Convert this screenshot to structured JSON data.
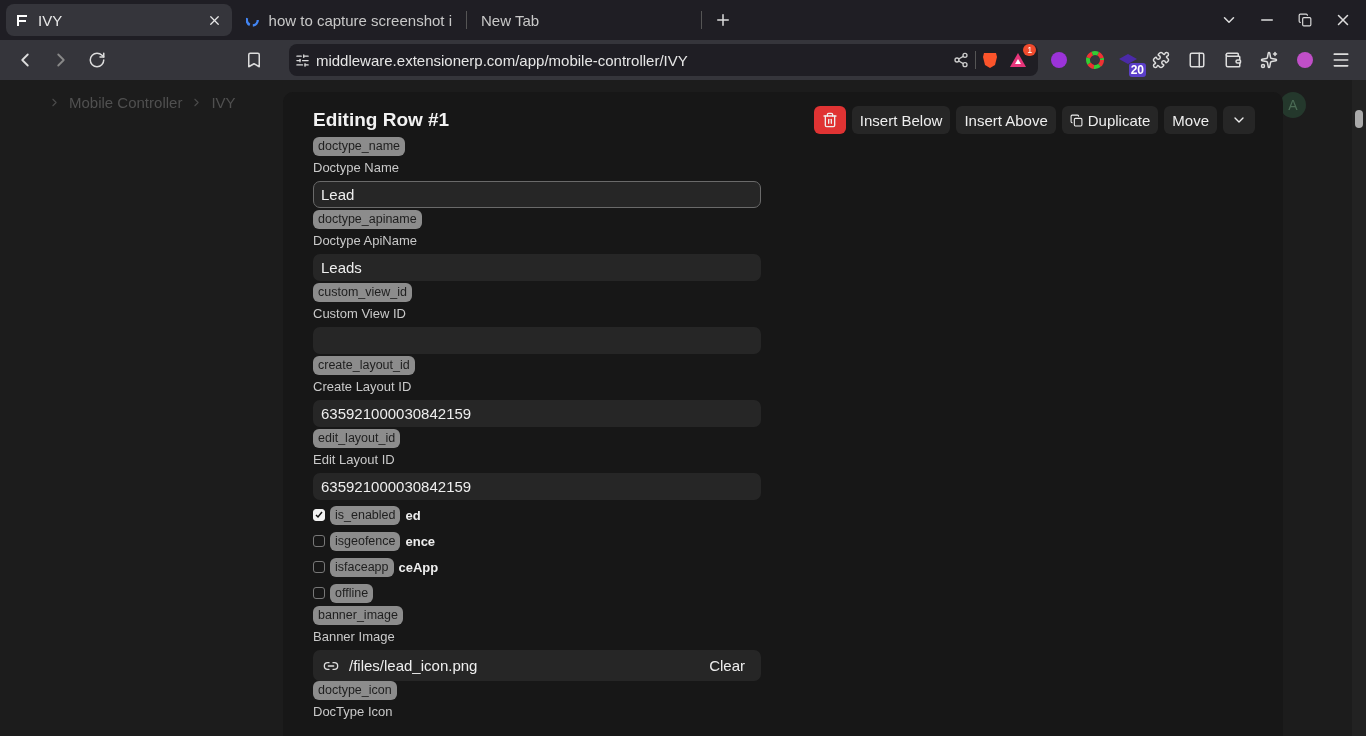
{
  "browser": {
    "tabs": [
      {
        "title": "IVY",
        "selected": true
      },
      {
        "title": "how to capture screenshot i",
        "selected": false
      },
      {
        "title": "New Tab",
        "selected": false
      }
    ],
    "url": "middleware.extensionerp.com/app/mobile-controller/IVY",
    "rewards_badge": "1",
    "extension_badge": "20"
  },
  "breadcrumb": [
    "Mobile Controller",
    "IVY"
  ],
  "avatar": "A",
  "dialog": {
    "title": "Editing Row #1",
    "actions": [
      {
        "kind": "delete"
      },
      {
        "kind": "text",
        "label": "Insert Below"
      },
      {
        "kind": "text",
        "label": "Insert Above"
      },
      {
        "kind": "duplicate",
        "label": "Duplicate"
      },
      {
        "kind": "text",
        "label": "Move"
      },
      {
        "kind": "menu"
      }
    ],
    "fields": [
      {
        "kind": "text",
        "tag": "doctype_name",
        "label": "Doctype Name",
        "value": "Lead",
        "focused": true
      },
      {
        "kind": "text",
        "tag": "doctype_apiname",
        "label": "Doctype ApiName",
        "value": "Leads",
        "focused": false
      },
      {
        "kind": "text",
        "tag": "custom_view_id",
        "label": "Custom View ID",
        "focused": false
      },
      {
        "kind": "text",
        "tag": "create_layout_id",
        "label": "Create Layout ID",
        "value": "635921000030842159",
        "focused": false
      },
      {
        "kind": "text",
        "tag": "edit_layout_id",
        "label": "Edit Layout ID",
        "value": "635921000030842159",
        "focused": false
      },
      {
        "kind": "check",
        "tag": "is_enabled",
        "label": "ed",
        "checked": true
      },
      {
        "kind": "check",
        "tag": "isgeofence",
        "label": "ence",
        "checked": false
      },
      {
        "kind": "check",
        "tag": "isfaceapp",
        "label": "ceApp",
        "checked": false
      },
      {
        "kind": "check",
        "tag": "offline",
        "checked": false
      },
      {
        "kind": "attach",
        "tag": "banner_image",
        "label": "Banner Image",
        "value": "/files/lead_icon.png",
        "action": "Clear"
      },
      {
        "kind": "heading",
        "tag": "doctype_icon",
        "label": "DocType Icon"
      }
    ]
  }
}
